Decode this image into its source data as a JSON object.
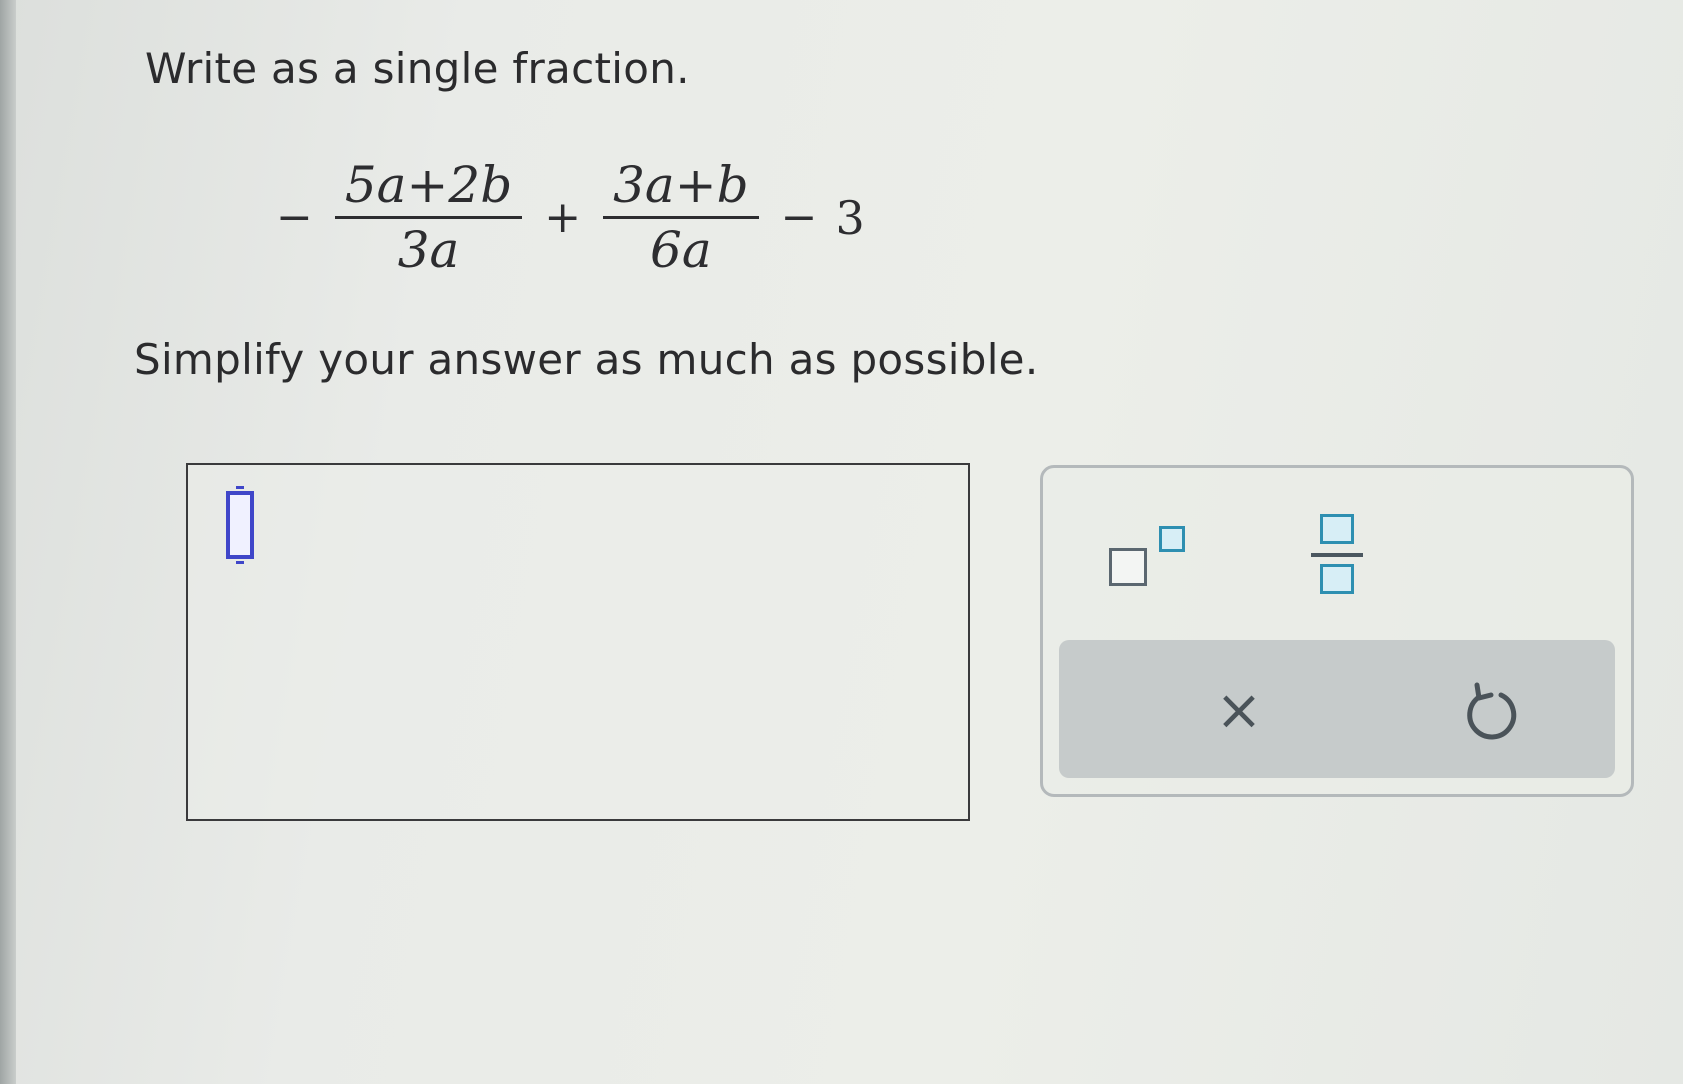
{
  "question": {
    "instruction": "Write as a single fraction.",
    "follow_up": "Simplify your answer as much as possible."
  },
  "expression": {
    "lead_sign": "−",
    "term1": {
      "numerator": "5a+2b",
      "denominator": "3a"
    },
    "plus": "+",
    "term2": {
      "numerator": "3a+b",
      "denominator": "6a"
    },
    "minus": "−",
    "constant": "3"
  },
  "answer": {
    "value": ""
  },
  "toolbar": {
    "exponent_icon": "exponent-template-icon",
    "fraction_icon": "fraction-template-icon",
    "clear_label": "×",
    "undo_icon": "undo-icon"
  },
  "colors": {
    "accent": "#2e8fb1",
    "cursor": "#3f46c9",
    "action_bar": "#c6cbcb"
  }
}
